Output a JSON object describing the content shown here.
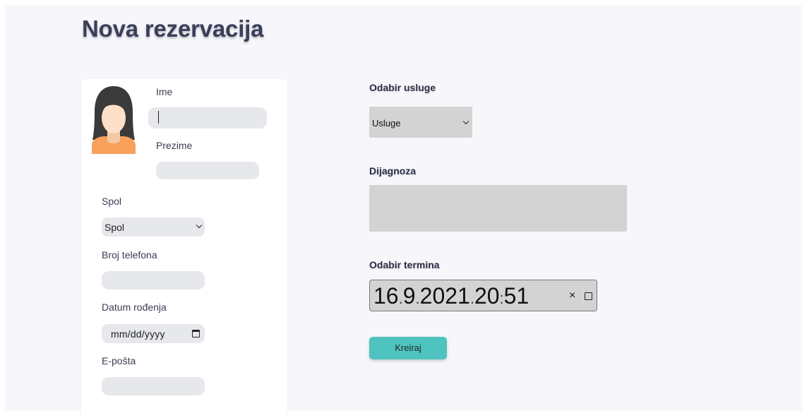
{
  "page": {
    "title": "Nova rezervacija"
  },
  "form_left": {
    "first_name_label": "Ime",
    "first_name_value": "",
    "last_name_label": "Prezime",
    "last_name_value": "",
    "gender_label": "Spol",
    "gender_select_value": "Spol",
    "phone_label": "Broj telefona",
    "phone_value": "",
    "birthdate_label": "Datum rođenja",
    "birthdate_placeholder": "mm/dd/yyyy",
    "email_label": "E-pošta",
    "email_value": ""
  },
  "form_right": {
    "service_label": "Odabir usluge",
    "service_select_value": "Usluge",
    "diagnosis_label": "Dijagnoza",
    "diagnosis_value": "",
    "appointment_label": "Odabir termina",
    "appointment_day": "16",
    "appointment_month": "9",
    "appointment_year": "2021",
    "appointment_hour": "20",
    "appointment_minute": "51",
    "clear_glyph": "×",
    "submit_label": "Kreiraj"
  },
  "colors": {
    "accent_button": "#4fc3bf",
    "avatar_hair": "#3a3a3a",
    "avatar_skin": "#fde0c7",
    "avatar_shirt": "#f8a15d"
  },
  "icons": {
    "avatar": "female-avatar-icon",
    "chevron": "chevron-down-icon",
    "calendar": "calendar-icon"
  }
}
